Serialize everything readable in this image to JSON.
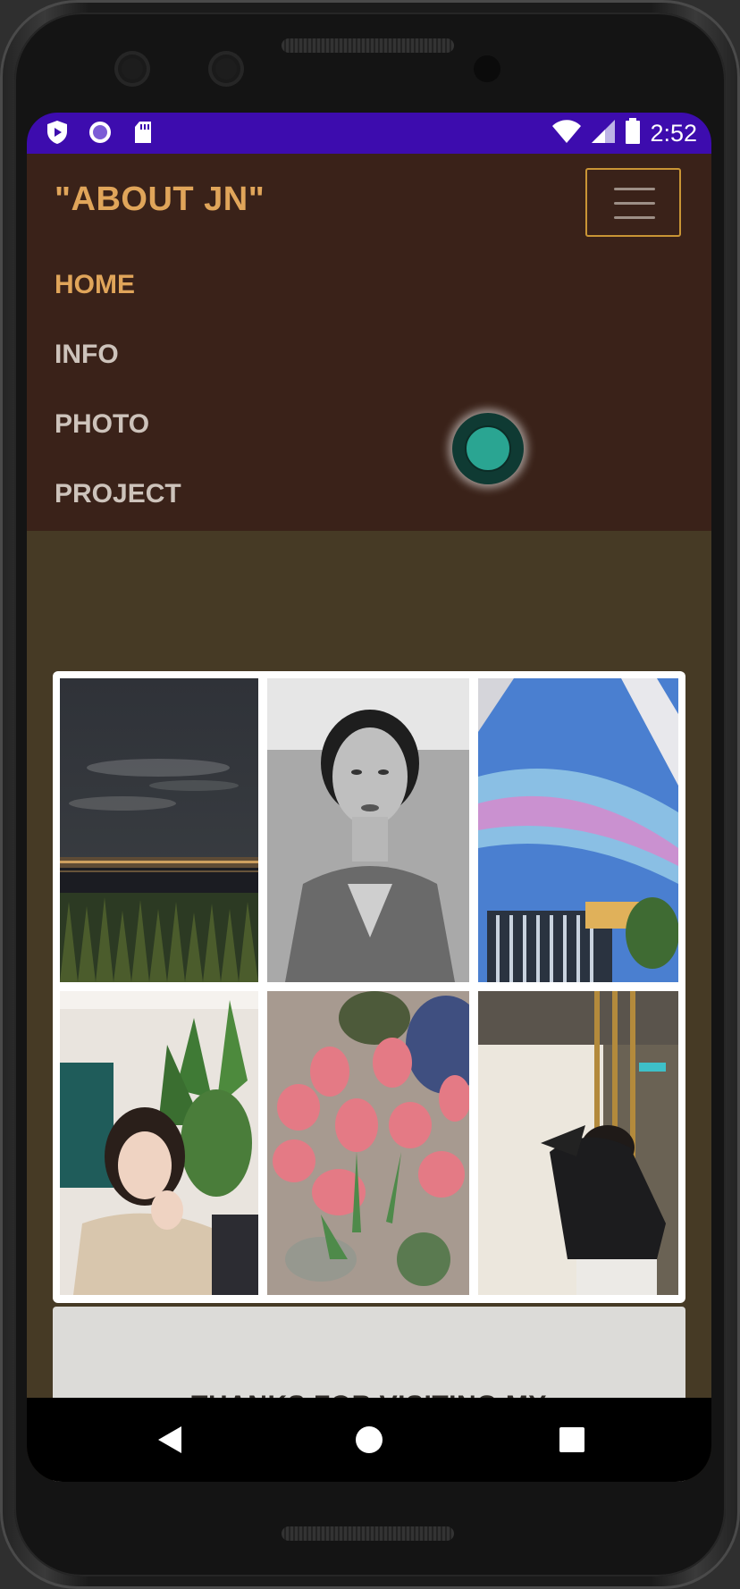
{
  "status_bar": {
    "time": "2:52",
    "left_icons": [
      "shield-play-icon",
      "record-circle-icon",
      "sd-card-icon"
    ],
    "right_icons": [
      "wifi-icon",
      "cell-signal-icon",
      "battery-icon"
    ]
  },
  "site": {
    "brand": "\"ABOUT JN\"",
    "menu_toggle_icon": "hamburger-icon",
    "nav": [
      {
        "label": "HOME",
        "active": true
      },
      {
        "label": "INFO",
        "active": false
      },
      {
        "label": "PHOTO",
        "active": false
      },
      {
        "label": "PROJECT",
        "active": false
      }
    ]
  },
  "gallery": {
    "photos": [
      "night river skyline",
      "black and white portrait",
      "iridescent sculpture sky",
      "woman in cafe with plants",
      "pink tulips bouquet",
      "person in leather jacket"
    ]
  },
  "footer": {
    "text": "THANKS FOR VISITING MY"
  },
  "android_nav": {
    "back": "back-icon",
    "home": "home-icon",
    "recents": "recents-icon"
  },
  "colors": {
    "status_bar": "#3d0cae",
    "navbar_bg": "#3a2219",
    "brand": "#e0a55a",
    "nav_link": "#cdc3bb",
    "content_bg": "#463a25",
    "footer_card": "#dcdbd8"
  }
}
